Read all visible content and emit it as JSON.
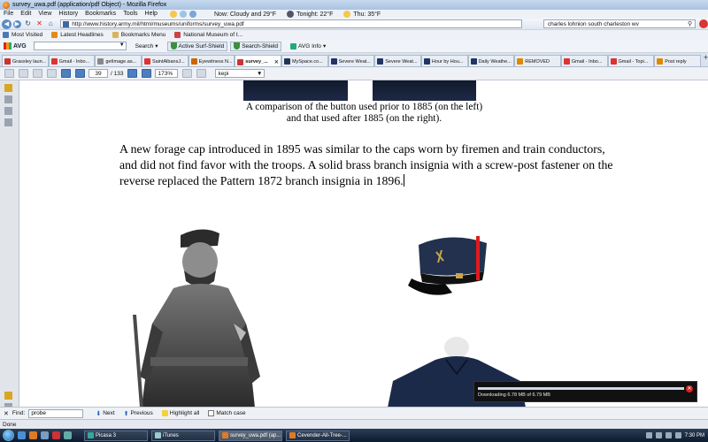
{
  "window": {
    "title": "survey_uwa.pdf (application/pdf Object) - Mozilla Firefox"
  },
  "menu": {
    "items": [
      "File",
      "Edit",
      "View",
      "History",
      "Bookmarks",
      "Tools",
      "Help"
    ],
    "weather_now": "Now: Cloudy and 29°F",
    "weather_tonight": "Tonight: 22°F",
    "weather_thu": "Thu: 35°F"
  },
  "nav": {
    "url": "http://www.history.army.mil/html/museums/uniforms/survey_uwa.pdf",
    "search": "charles lohnion south charleston wv"
  },
  "bookmarks": [
    "Most Visited",
    "Latest Headlines",
    "Bookmarks Menu",
    "National Museum of t..."
  ],
  "avg": {
    "logo": "AVG",
    "search_label": "Search",
    "active_surf": "Active Surf-Shield",
    "search_shield": "Search-Shield",
    "info": "AVG Info"
  },
  "tabs": [
    {
      "label": "Grassley laun...",
      "color": "#c33"
    },
    {
      "label": "Gmail - Inbo...",
      "color": "#d33"
    },
    {
      "label": "getImage.as...",
      "color": "#888"
    },
    {
      "label": "SaintAlbansJ...",
      "color": "#d33"
    },
    {
      "label": "Eyewitness N...",
      "color": "#c60"
    },
    {
      "label": "survey_...",
      "color": "#c33",
      "active": true
    },
    {
      "label": "MySpace.co...",
      "color": "#235"
    },
    {
      "label": "Severe Weat...",
      "color": "#236"
    },
    {
      "label": "Severe Weat...",
      "color": "#236"
    },
    {
      "label": "Hour by Hou...",
      "color": "#236"
    },
    {
      "label": "Daily Weathe...",
      "color": "#236"
    },
    {
      "label": "REMOVED",
      "color": "#d80"
    },
    {
      "label": "Gmail - Inbo...",
      "color": "#d33"
    },
    {
      "label": "Gmail - Topi...",
      "color": "#d33"
    },
    {
      "label": "Post reply",
      "color": "#d80"
    }
  ],
  "pdf": {
    "page": "39",
    "page_total": "/ 133",
    "zoom": "173%",
    "find": "kepi"
  },
  "document": {
    "caption_line1": "A comparison of the button used prior to 1885 (on the left)",
    "caption_line2": "and that used after 1885 (on the right).",
    "paragraph": "A new forage cap introduced in 1895 was similar to the caps worn by firemen and train conductors, and did not find favor with the troops.  A solid brass branch insignia with a screw-post fastener on the reverse replaced the Pattern 1872 branch insignia in 1896."
  },
  "download": {
    "text": "Downloading 6.78 MB of 6.79 MB",
    "progress": 0.998
  },
  "findbar": {
    "label": "Find:",
    "value": "probe",
    "next": "Next",
    "previous": "Previous",
    "highlight": "Highlight all",
    "matchcase": "Match case"
  },
  "status": {
    "text": "Done"
  },
  "taskbar": {
    "tasks": [
      "Picasa 3",
      "iTunes",
      "survey_uwa.pdf (ap...",
      "Cevender-All-Tree-..."
    ],
    "active_index": 2,
    "clock": "7:30 PM"
  }
}
